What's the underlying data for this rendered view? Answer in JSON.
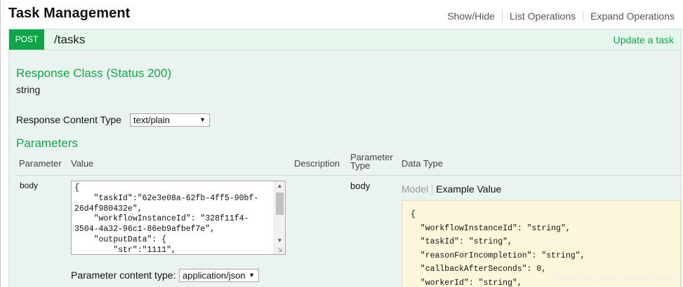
{
  "header": {
    "title": "Task Management",
    "ops": {
      "show_hide": "Show/Hide",
      "list_operations": "List Operations",
      "expand_operations": "Expand Operations"
    }
  },
  "operation": {
    "method": "POST",
    "path": "/tasks",
    "summary": "Update a task",
    "response_class_heading": "Response Class (Status 200)",
    "response_model": "string",
    "response_content_type_label": "Response Content Type",
    "response_content_type_value": "text/plain",
    "parameters_heading": "Parameters",
    "columns": {
      "parameter": "Parameter",
      "value": "Value",
      "description": "Description",
      "parameter_type_line1": "Parameter",
      "parameter_type_line2": "Type",
      "data_type": "Data Type"
    },
    "param": {
      "name": "body",
      "value_text": "{\n    \"taskId\":\"62e3e08a-62fb-4ff5-90bf-\n26d4f980432e\",\n    \"workflowInstanceId\": \"328f11f4-\n3504-4a32-96c1-86eb9afbef7e\",\n    \"outputData\": {\n        \"str\":\"1111\",",
      "param_type": "body",
      "content_type_label": "Parameter content type:",
      "content_type_value": "application/json",
      "model_tab": "Model",
      "example_tab": "Example Value",
      "example_value": "{\n  \"workflowInstanceId\": \"string\",\n  \"taskId\": \"string\",\n  \"reasonForIncompletion\": \"string\",\n  \"callbackAfterSeconds\": 0,\n  \"workerId\": \"string\","
    }
  },
  "watermark": "https://blog.csdn.net/wh09091",
  "colors": {
    "post_green": "#10a54a",
    "op_background": "#ebf3f0",
    "op_border": "#c3e8d1",
    "example_background": "#fcf6db"
  }
}
